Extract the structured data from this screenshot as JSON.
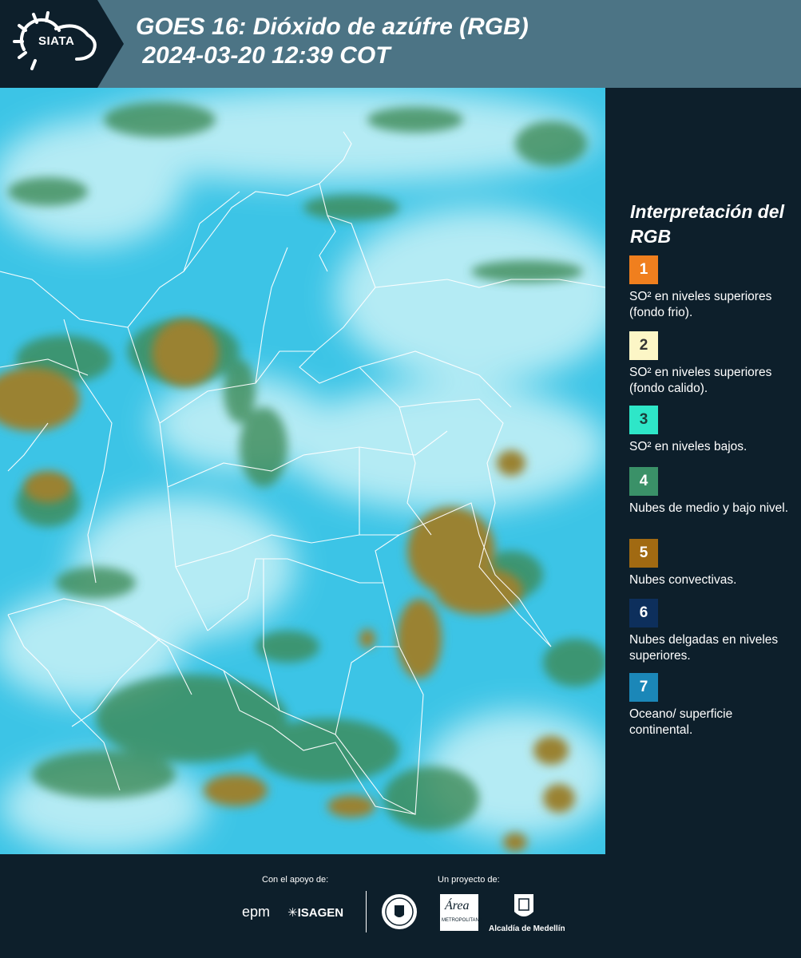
{
  "header": {
    "logo_text": "SIATA",
    "title": "GOES 16: Dióxido de azúfre (RGB)\n 2024-03-20 12:39 COT"
  },
  "legend": {
    "title": "Interpretación del RGB",
    "items": [
      {
        "number": "1",
        "color": "#f07f1e",
        "text_color": "#ffffff",
        "label": "SO² en niveles superiores (fondo frio)."
      },
      {
        "number": "2",
        "color": "#fcf6c6",
        "text_color": "#333333",
        "label": "SO² en niveles superiores (fondo calido)."
      },
      {
        "number": "3",
        "color": "#2ee6c8",
        "text_color": "#1b3d3a",
        "label": "SO² en niveles bajos."
      },
      {
        "number": "4",
        "color": "#3a9168",
        "text_color": "#ffffff",
        "label": "Nubes de medio y bajo nivel."
      },
      {
        "number": "5",
        "color": "#a16a12",
        "text_color": "#ffffff",
        "label": "Nubes convectivas."
      },
      {
        "number": "6",
        "color": "#0d2f5c",
        "text_color": "#ffffff",
        "label": "Nubes delgadas en niveles superiores."
      },
      {
        "number": "7",
        "color": "#1b87b8",
        "text_color": "#ffffff",
        "label": "Oceano/ superficie continental."
      }
    ]
  },
  "footer": {
    "support_caption": "Con el apoyo de:",
    "project_caption": "Un proyecto de:",
    "sponsors": [
      "epm",
      "ISAGEN"
    ],
    "partners": [
      "METROPOLITANA",
      "Alcaldía de Medellín"
    ]
  },
  "map": {
    "colors": {
      "background_cyan": "#3cc4e6",
      "haze": "#c9f2f7",
      "green_cloud": "#3c8a57",
      "convective": "#9a8233",
      "borders": "#ffffff"
    }
  }
}
